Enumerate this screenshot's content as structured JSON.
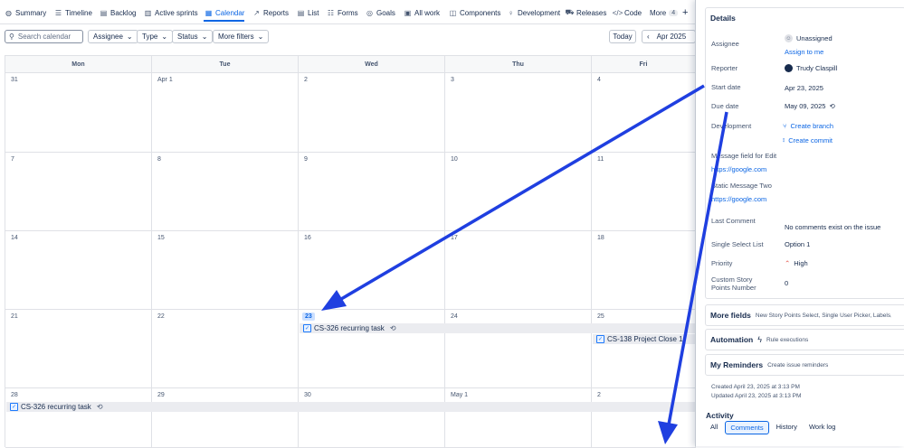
{
  "nav": {
    "items": [
      {
        "label": "Summary",
        "icon": "globe-icon"
      },
      {
        "label": "Timeline",
        "icon": "timeline-icon"
      },
      {
        "label": "Backlog",
        "icon": "backlog-icon"
      },
      {
        "label": "Active sprints",
        "icon": "board-icon"
      },
      {
        "label": "Calendar",
        "icon": "calendar-icon"
      },
      {
        "label": "Reports",
        "icon": "reports-icon"
      },
      {
        "label": "List",
        "icon": "list-icon"
      },
      {
        "label": "Forms",
        "icon": "forms-icon"
      },
      {
        "label": "Goals",
        "icon": "goals-icon"
      },
      {
        "label": "All work",
        "icon": "all-work-icon"
      },
      {
        "label": "Components",
        "icon": "components-icon"
      },
      {
        "label": "Development",
        "icon": "development-icon"
      },
      {
        "label": "Releases",
        "icon": "releases-icon"
      },
      {
        "label": "Code",
        "icon": "code-icon"
      }
    ],
    "active": "Calendar",
    "more_label": "More",
    "more_count": "4"
  },
  "toolbar": {
    "search_placeholder": "Search calendar",
    "filters": [
      "Assignee",
      "Type",
      "Status",
      "More filters"
    ],
    "today_label": "Today",
    "month_label": "Apr 2025"
  },
  "calendar": {
    "weekdays": [
      "Mon",
      "Tue",
      "Wed",
      "Thu",
      "Fri"
    ],
    "weeks": [
      [
        "31",
        "Apr 1",
        "2",
        "3",
        "4"
      ],
      [
        "7",
        "8",
        "9",
        "10",
        "11"
      ],
      [
        "14",
        "15",
        "16",
        "17",
        "18"
      ],
      [
        "21",
        "22",
        "23",
        "24",
        "25"
      ],
      [
        "28",
        "29",
        "30",
        "May 1",
        "2"
      ]
    ],
    "today": "23",
    "events": [
      {
        "label": "CS-326 recurring task",
        "recurring": true
      },
      {
        "label": "CS-138 Project Close 1",
        "recurring": false
      },
      {
        "label": "CS-326 recurring task",
        "recurring": true
      }
    ]
  },
  "details": {
    "title": "Details",
    "assignee_label": "Assignee",
    "assignee_value": "Unassigned",
    "assign_to_me": "Assign to me",
    "reporter_label": "Reporter",
    "reporter_value": "Trudy Claspill",
    "start_date_label": "Start date",
    "start_date_value": "Apr 23, 2025",
    "due_date_label": "Due date",
    "due_date_value": "May 09, 2025",
    "development_label": "Development",
    "create_branch": "Create branch",
    "create_commit": "Create commit",
    "message_field_label": "Message field for Edit",
    "message_field_value": "https://google.com",
    "static_message_label": "Static Message Two",
    "static_message_value": "https://google.com",
    "last_comment_label": "Last Comment",
    "last_comment_value": "No comments exist on the issue",
    "single_select_label": "Single Select List",
    "single_select_value": "Option 1",
    "priority_label": "Priority",
    "priority_value": "High",
    "story_points_label_1": "Custom Story",
    "story_points_label_2": "Points Number",
    "story_points_value": "0"
  },
  "more_fields": {
    "title": "More fields",
    "summary": "New Story Points Select, Single User Picker, Labels, Story Point"
  },
  "automation": {
    "title": "Automation",
    "sub": "Rule executions"
  },
  "reminders": {
    "title": "My Reminders",
    "sub": "Create issue reminders"
  },
  "meta": {
    "created": "Created April 23, 2025 at 3:13 PM",
    "updated": "Updated April 23, 2025 at 3:13 PM"
  },
  "activity": {
    "title": "Activity",
    "tabs": [
      "All",
      "Comments",
      "History",
      "Work log"
    ],
    "active_tab": "Comments"
  },
  "colors": {
    "accent": "#0c66e4",
    "arrow": "#1f3fe0",
    "priority_high": "#e2483d"
  }
}
